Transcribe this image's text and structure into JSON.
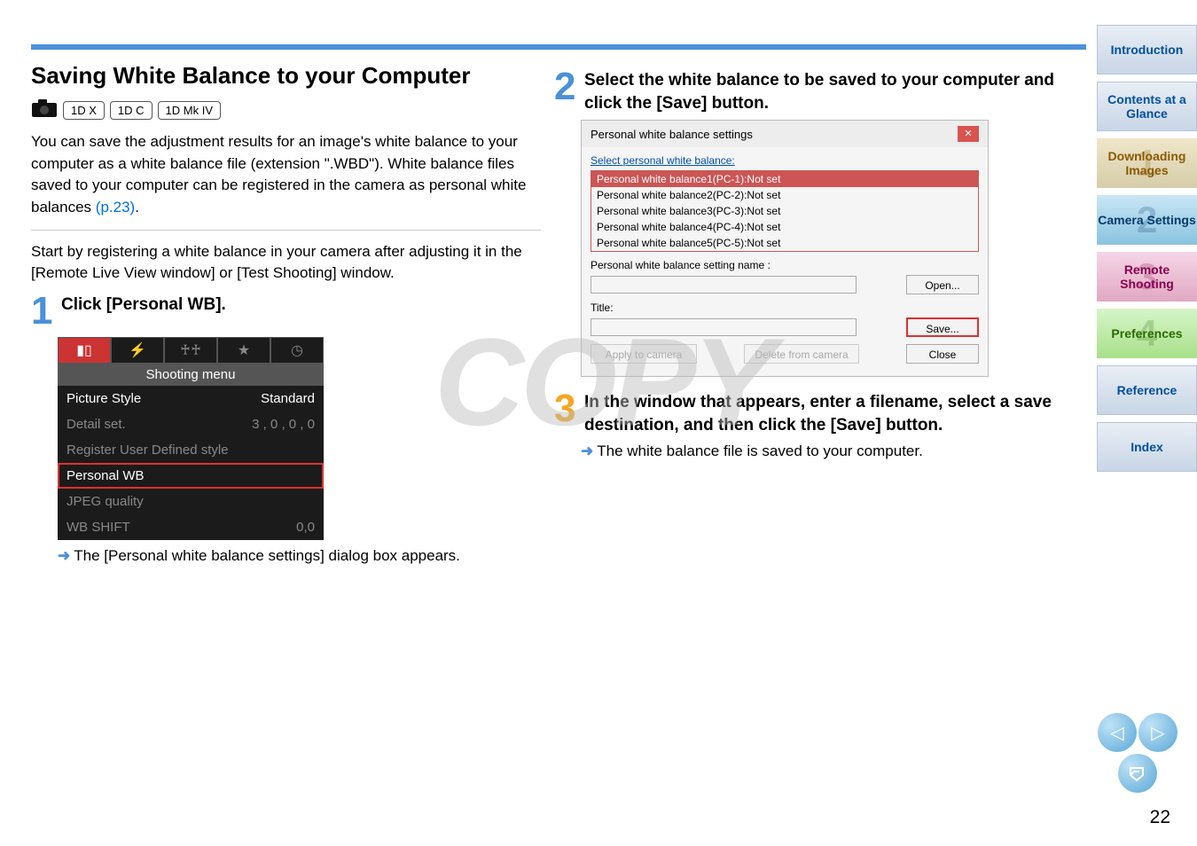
{
  "title": "Saving White Balance to your Computer",
  "badges": [
    "1D X",
    "1D C",
    "1D Mk IV"
  ],
  "intro": "You can save the adjustment results for an image's white balance to your computer as a white balance file (extension \".WBD\"). White balance files saved to your computer can be registered in the camera as personal white balances ",
  "intro_link": "(p.23)",
  "intro_after": ".",
  "lead_in": "Start by registering a white balance in your camera after adjusting it in the [Remote Live View window] or [Test Shooting] window.",
  "steps": {
    "s1": {
      "num": "1",
      "text": "Click [Personal WB]."
    },
    "s2": {
      "num": "2",
      "text": "Select the white balance to be saved to your computer and click the [Save] button."
    },
    "s3": {
      "num": "3",
      "text": "In the window that appears, enter a filename, select a save destination, and then click the [Save] button."
    }
  },
  "s1_result": "The [Personal white balance settings] dialog box appears.",
  "s3_result": "The white balance file is saved to your computer.",
  "shooting_menu": {
    "header": "Shooting menu",
    "items": [
      {
        "label": "Picture Style",
        "value": "Standard",
        "dim": false
      },
      {
        "label": "Detail set.",
        "value": "3 , 0 , 0 , 0",
        "dim": true
      },
      {
        "label": "Register User Defined style",
        "value": "",
        "dim": true
      },
      {
        "label": "Personal WB",
        "value": "",
        "dim": false,
        "hi": true
      },
      {
        "label": "JPEG quality",
        "value": "",
        "dim": true
      },
      {
        "label": "WB SHIFT",
        "value": "0,0",
        "dim": true
      }
    ]
  },
  "dialog": {
    "title": "Personal white balance settings",
    "select_label": "Select personal white balance:",
    "entries": [
      "Personal white balance1(PC-1):Not set",
      "Personal white balance2(PC-2):Not set",
      "Personal white balance3(PC-3):Not set",
      "Personal white balance4(PC-4):Not set",
      "Personal white balance5(PC-5):Not set"
    ],
    "name_label": "Personal white balance setting name :",
    "title_label": "Title:",
    "btn_open": "Open...",
    "btn_save": "Save...",
    "btn_apply": "Apply to camera",
    "btn_delete": "Delete from camera",
    "btn_close": "Close"
  },
  "sidebar": {
    "intro": "Introduction",
    "contents": "Contents at a Glance",
    "s1": "Downloading Images",
    "s2": "Camera Settings",
    "s3": "Remote Shooting",
    "s4": "Preferences",
    "ref": "Reference",
    "index": "Index"
  },
  "watermark": "COPY",
  "page_number": "22"
}
